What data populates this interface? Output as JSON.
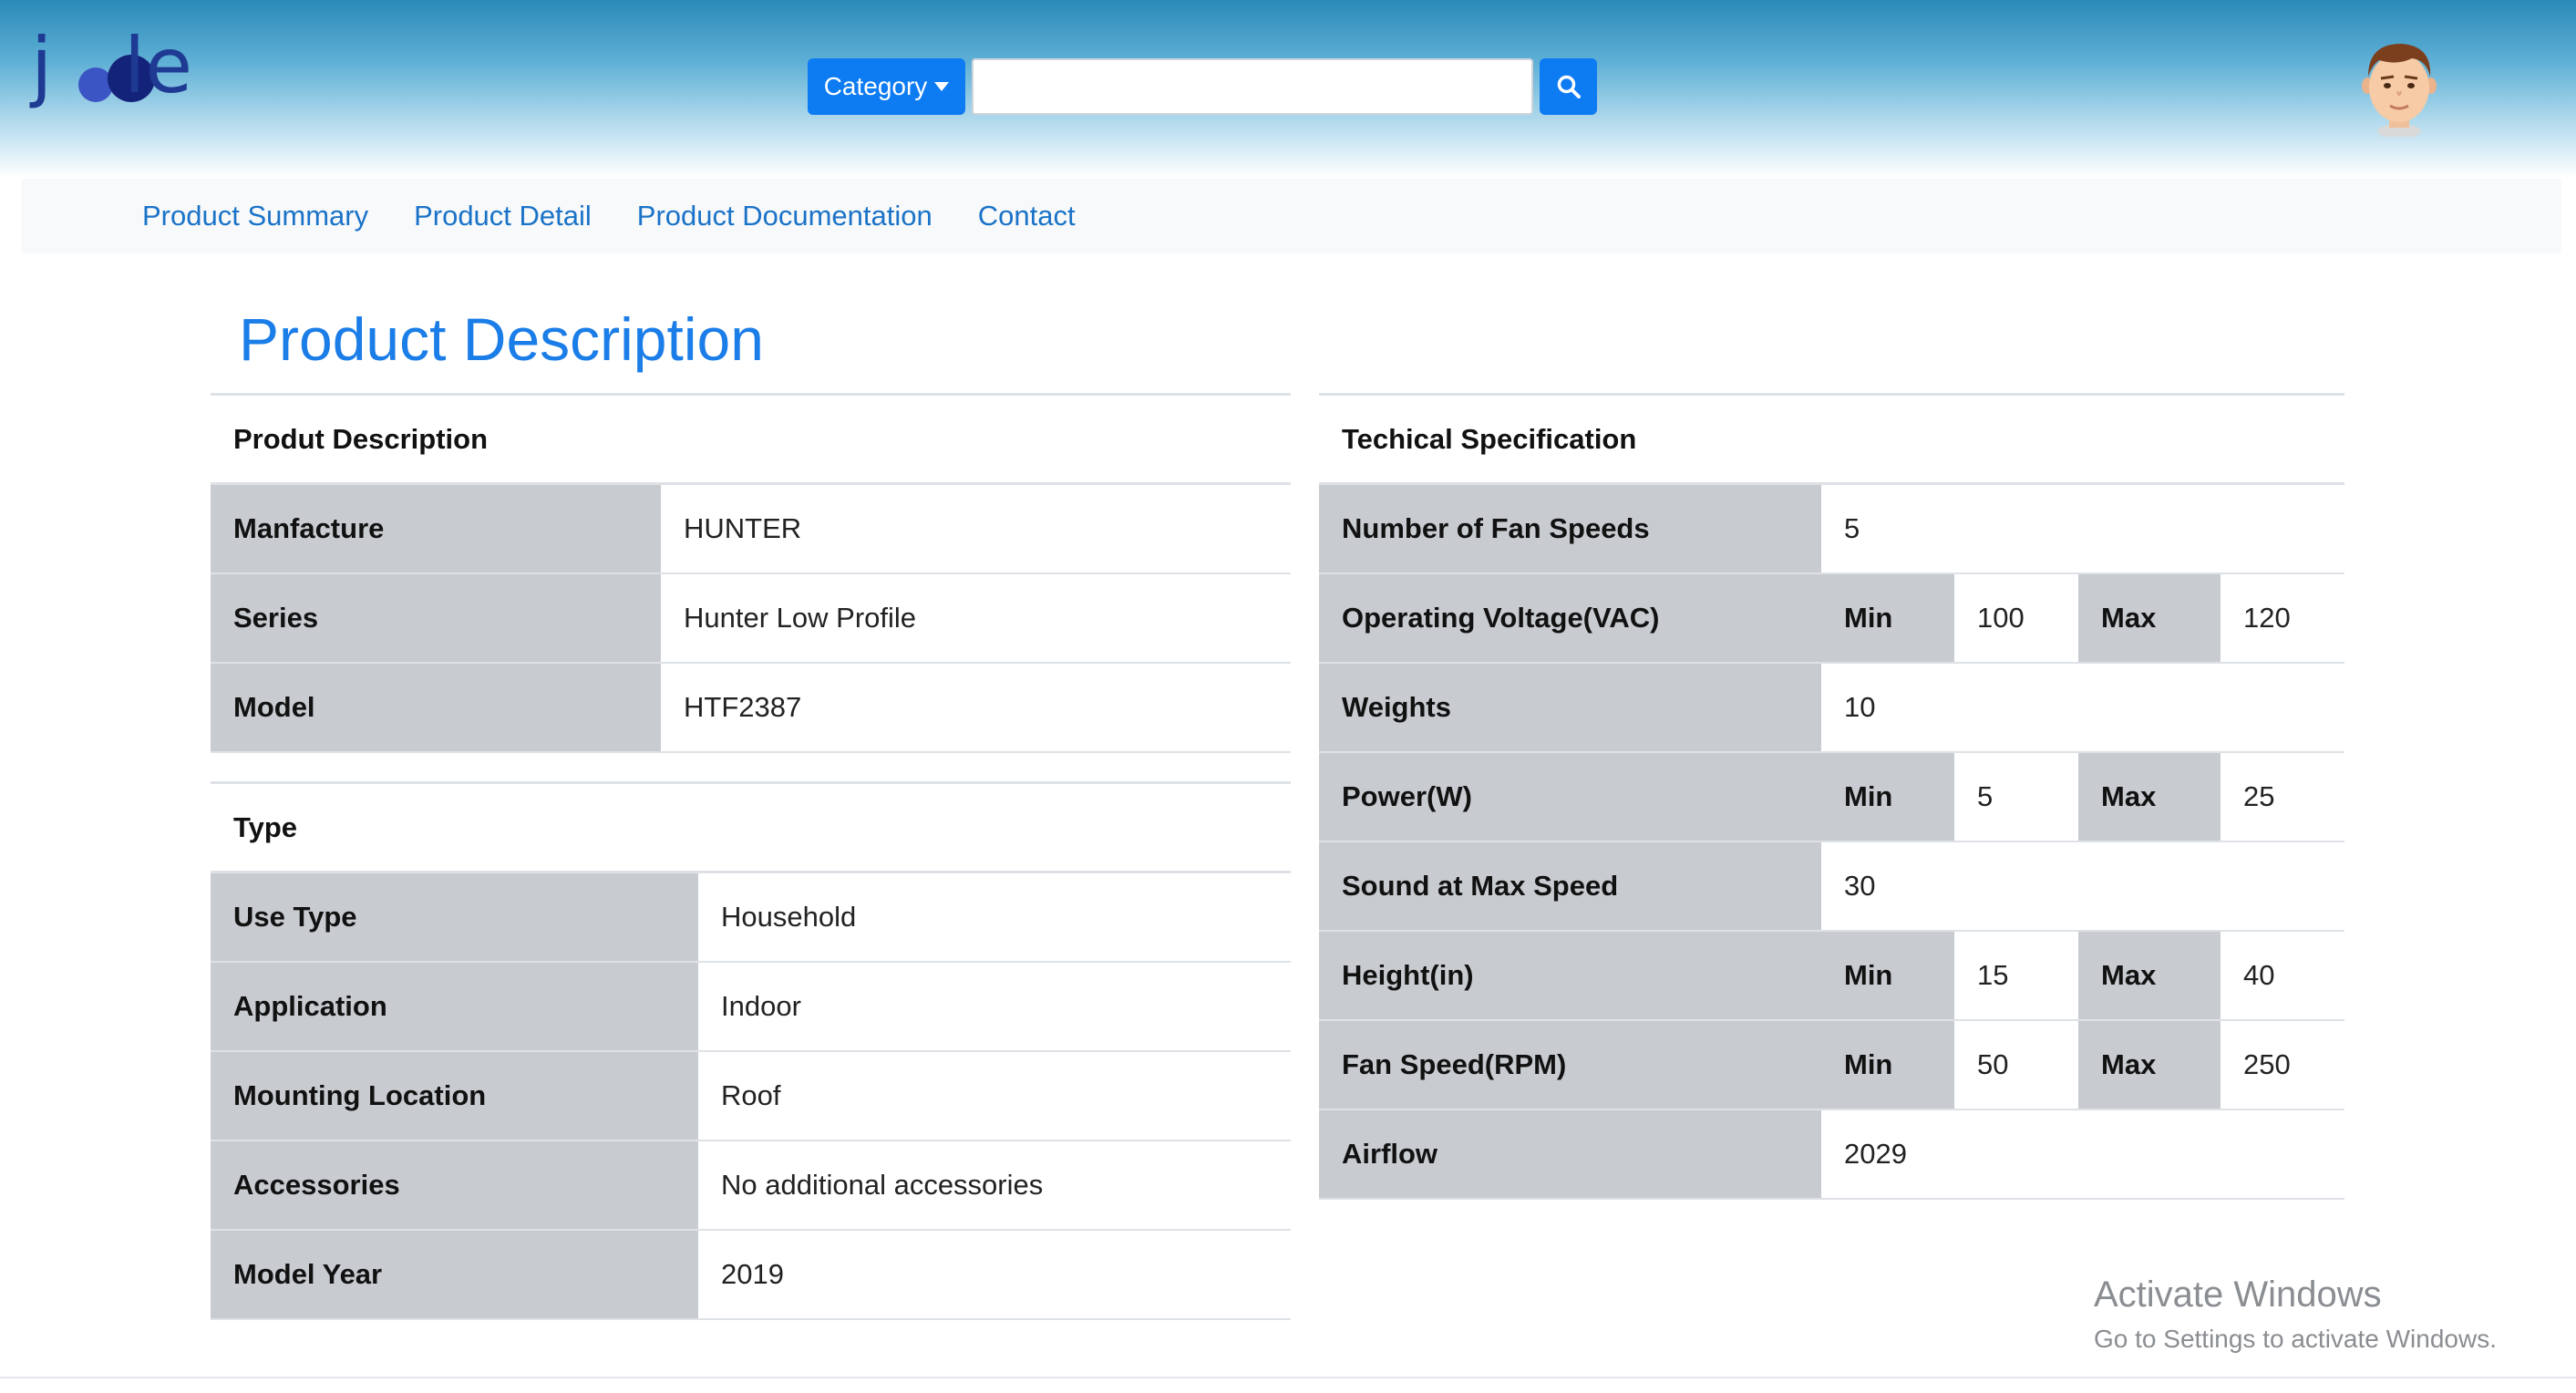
{
  "header": {
    "logo": {
      "letters": [
        "j",
        "le"
      ],
      "brand_colors": {
        "dark": "#14237a",
        "mid": "#3b55c4",
        "text": "#1f3a93"
      }
    },
    "search": {
      "category_label": "Category",
      "input_value": "",
      "input_placeholder": "",
      "search_icon": "search-icon"
    },
    "avatar_icon": "user-avatar-icon"
  },
  "nav": {
    "links": [
      "Product Summary",
      "Product Detail",
      "Product Documentation",
      "Contact"
    ]
  },
  "page": {
    "title": "Product Description"
  },
  "description": {
    "heading": "Produt Description",
    "rows": [
      {
        "label": "Manfacture",
        "value": "HUNTER"
      },
      {
        "label": "Series",
        "value": "Hunter Low Profile"
      },
      {
        "label": "Model",
        "value": "HTF2387"
      }
    ]
  },
  "type": {
    "heading": "Type",
    "rows": [
      {
        "label": "Use Type",
        "value": "Household"
      },
      {
        "label": "Application",
        "value": "Indoor"
      },
      {
        "label": "Mounting Location",
        "value": "Roof"
      },
      {
        "label": "Accessories",
        "value": "No additional accessories"
      },
      {
        "label": "Model Year",
        "value": "2019"
      }
    ]
  },
  "spec": {
    "heading": "Techical Specification",
    "min_label": "Min",
    "max_label": "Max",
    "rows": [
      {
        "label": "Number of Fan Speeds",
        "value": "5"
      },
      {
        "label": "Operating Voltage(VAC)",
        "min": "100",
        "max": "120"
      },
      {
        "label": "Weights",
        "value": "10"
      },
      {
        "label": "Power(W)",
        "min": "5",
        "max": "25"
      },
      {
        "label": "Sound at Max Speed",
        "value": "30"
      },
      {
        "label": "Height(in)",
        "min": "15",
        "max": "40"
      },
      {
        "label": "Fan Speed(RPM)",
        "min": "50",
        "max": "250"
      },
      {
        "label": "Airflow",
        "value": "2029"
      }
    ]
  },
  "watermark": {
    "line1": "Activate Windows",
    "line2": "Go to Settings to activate Windows."
  },
  "colors": {
    "accent": "#0d7bf2",
    "link": "#1a73c8",
    "title": "#1a7de8",
    "label_bg": "#c8ccd1"
  }
}
